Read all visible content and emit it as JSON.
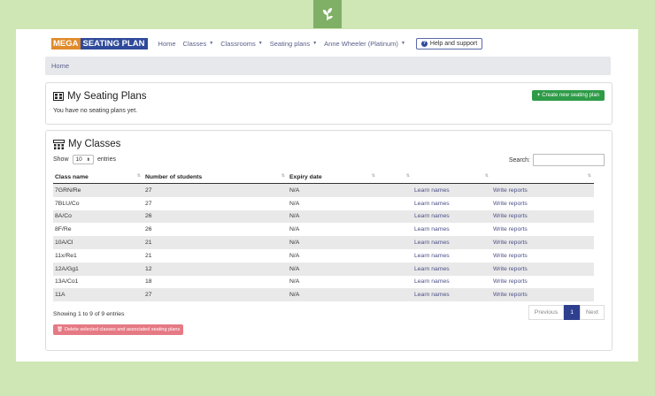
{
  "logo": {
    "part1": "MEGA",
    "part2": "SEATING PLAN"
  },
  "nav": {
    "home": "Home",
    "classes": "Classes",
    "classrooms": "Classrooms",
    "seating_plans": "Seating plans",
    "user": "Anne Wheeler (Platinum)",
    "help": "Help and support"
  },
  "breadcrumb": {
    "home": "Home"
  },
  "seating": {
    "title": "My Seating Plans",
    "empty": "You have no seating plans yet.",
    "create": "Create new seating plan"
  },
  "classes": {
    "title": "My Classes",
    "show_label": "Show",
    "entries_value": "10",
    "entries_label": "entries",
    "search_label": "Search:",
    "columns": [
      "Class name",
      "Number of students",
      "Expiry date",
      "",
      "",
      ""
    ],
    "rows": [
      {
        "name": "7GRN/Re",
        "students": "27",
        "expiry": "N/A",
        "learn": "Learn names",
        "reports": "Write reports"
      },
      {
        "name": "7BLU/Co",
        "students": "27",
        "expiry": "N/A",
        "learn": "Learn names",
        "reports": "Write reports"
      },
      {
        "name": "8A/Co",
        "students": "26",
        "expiry": "N/A",
        "learn": "Learn names",
        "reports": "Write reports"
      },
      {
        "name": "8F/Re",
        "students": "26",
        "expiry": "N/A",
        "learn": "Learn names",
        "reports": "Write reports"
      },
      {
        "name": "10A/Cl",
        "students": "21",
        "expiry": "N/A",
        "learn": "Learn names",
        "reports": "Write reports"
      },
      {
        "name": "11x/Re1",
        "students": "21",
        "expiry": "N/A",
        "learn": "Learn names",
        "reports": "Write reports"
      },
      {
        "name": "12A/Gg1",
        "students": "12",
        "expiry": "N/A",
        "learn": "Learn names",
        "reports": "Write reports"
      },
      {
        "name": "13A/Co1",
        "students": "18",
        "expiry": "N/A",
        "learn": "Learn names",
        "reports": "Write reports"
      },
      {
        "name": "11A",
        "students": "27",
        "expiry": "N/A",
        "learn": "Learn names",
        "reports": "Write reports"
      }
    ],
    "showing": "Showing 1 to 9 of 9 entries",
    "pager": {
      "previous": "Previous",
      "page": "1",
      "next": "Next"
    },
    "delete": "Delete selected classes and associated seating plans"
  }
}
